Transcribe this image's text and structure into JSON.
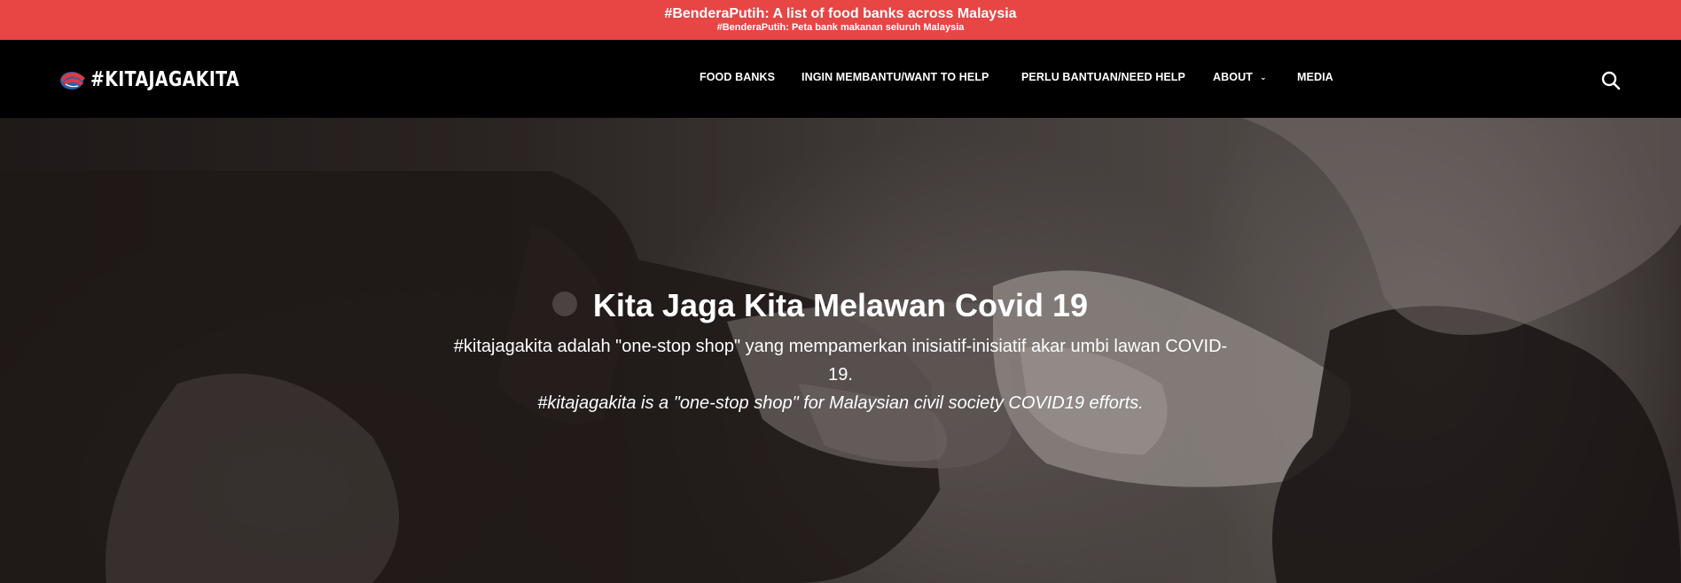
{
  "announcement": {
    "title": "#BenderaPutih: A list of food banks across Malaysia",
    "subtitle": "#BenderaPutih: Peta bank makanan seluruh Malaysia"
  },
  "header": {
    "logo_text": "#KITAJAGAKITA",
    "nav": [
      {
        "label": "FOOD BANKS"
      },
      {
        "label": "INGIN MEMBANTU/WANT TO HELP"
      },
      {
        "label": "PERLU BANTUAN/NEED HELP"
      },
      {
        "label": "ABOUT",
        "has_dropdown": true
      },
      {
        "label": "MEDIA"
      }
    ],
    "search_icon": "search-icon"
  },
  "hero": {
    "title": "Kita Jaga Kita Melawan Covid 19",
    "description_ms": "#kitajagakita adalah \"one-stop shop\" yang mempamerkan inisiatif-inisiatif akar umbi lawan COVID-19.",
    "description_en": "#kitajagakita is a \"one-stop shop\" for Malaysian civil society COVID19 efforts."
  },
  "colors": {
    "announcement_bg": "#e84545",
    "header_bg": "#000000",
    "text": "#ffffff",
    "logo_red": "#e0393e",
    "logo_blue": "#2b5fa8"
  }
}
